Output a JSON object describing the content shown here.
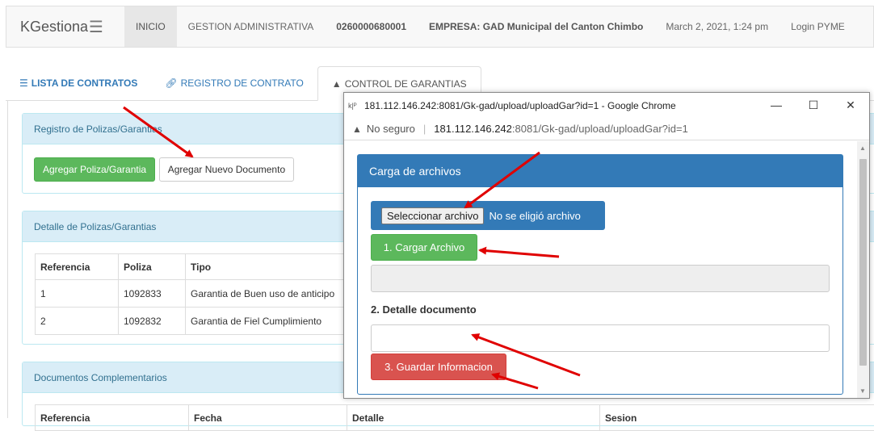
{
  "navbar": {
    "brand": "KGestiona",
    "items": [
      "INICIO",
      "GESTION ADMINISTRATIVA",
      "0260000680001",
      "EMPRESA: GAD Municipal del Canton Chimbo",
      "March 2, 2021, 1:24 pm",
      "Login PYME"
    ]
  },
  "tabs": [
    "LISTA DE CONTRATOS",
    "REGISTRO DE CONTRATO",
    "CONTROL DE GARANTIAS"
  ],
  "polizas": {
    "title": "Registro de Polizas/Garantias",
    "add_button": "Agregar Poliza/Garantia",
    "new_doc_button": "Agregar Nuevo Documento"
  },
  "detalle": {
    "title": "Detalle de Polizas/Garantias",
    "headers": [
      "Referencia",
      "Poliza",
      "Tipo"
    ],
    "rows": [
      [
        "1",
        "1092833",
        "Garantia de Buen uso de anticipo"
      ],
      [
        "2",
        "1092832",
        "Garantia de Fiel Cumplimiento"
      ]
    ]
  },
  "documentos": {
    "title": "Documentos Complementarios",
    "headers": [
      "Referencia",
      "Fecha",
      "Detalle",
      "Sesion"
    ]
  },
  "popup": {
    "window_title": "181.112.146.242:8081/Gk-gad/upload/uploadGar?id=1 - Google Chrome",
    "not_secure": "No seguro",
    "url_host": "181.112.146.242",
    "url_path": ":8081/Gk-gad/upload/uploadGar?id=1",
    "panel_title": "Carga de archivos",
    "file_button": "Seleccionar archivo",
    "file_status": "No se eligió archivo",
    "load_button": "1. Cargar Archivo",
    "detail_label": "2. Detalle documento",
    "save_button": "3. Guardar Informacion"
  },
  "colors": {
    "primary": "#337ab7",
    "success": "#5cb85c",
    "danger": "#d9534f",
    "info_bg": "#d9edf7",
    "arrow": "#e00000"
  }
}
